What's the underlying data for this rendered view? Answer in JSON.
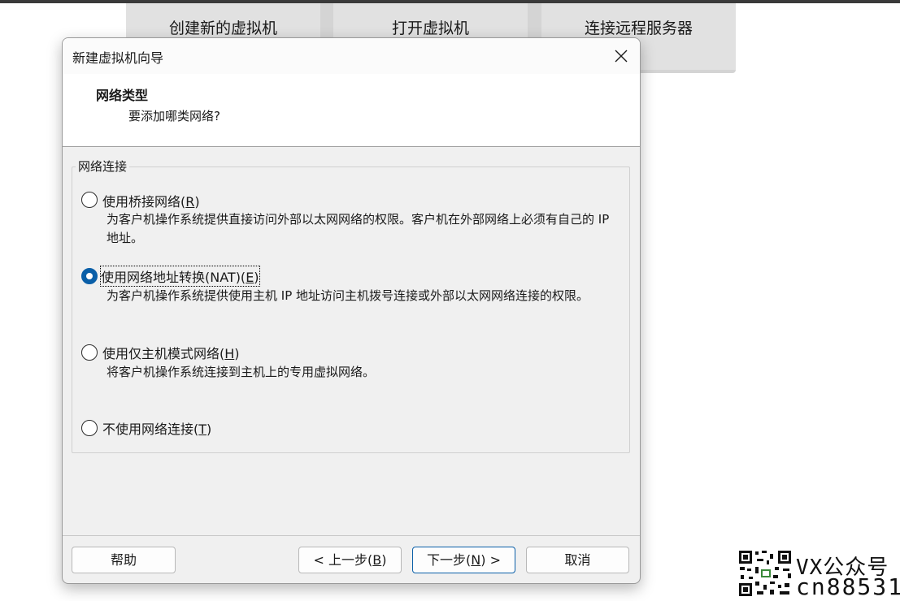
{
  "home": {
    "tiles": [
      "创建新的虚拟机",
      "打开虚拟机",
      "连接远程服务器"
    ]
  },
  "dialog": {
    "title": "新建虚拟机向导",
    "header": {
      "title": "网络类型",
      "subtitle": "要添加哪类网络?"
    },
    "group_label": "网络连接",
    "options": [
      {
        "label": "使用桥接网络(",
        "accel": "R",
        "label_end": ")",
        "description": "为客户机操作系统提供直接访问外部以太网网络的权限。客户机在外部网络上必须有自己的 IP 地址。",
        "selected": false
      },
      {
        "label": "使用网络地址转换(NAT)(",
        "accel": "E",
        "label_end": ")",
        "description": "为客户机操作系统提供使用主机 IP 地址访问主机拨号连接或外部以太网网络连接的权限。",
        "selected": true
      },
      {
        "label": "使用仅主机模式网络(",
        "accel": "H",
        "label_end": ")",
        "description": "将客户机操作系统连接到主机上的专用虚拟网络。",
        "selected": false
      },
      {
        "label": "不使用网络连接(",
        "accel": "T",
        "label_end": ")",
        "description": "",
        "selected": false
      }
    ],
    "buttons": {
      "help": "帮助",
      "back_prefix": "< 上一步(",
      "back_accel": "B",
      "back_suffix": ")",
      "next_prefix": "下一步(",
      "next_accel": "N",
      "next_suffix": ") >",
      "cancel": "取消"
    }
  },
  "watermark": {
    "line1": "VX公众号",
    "line2": "cn88531"
  },
  "colors": {
    "accent": "#0a5fa8",
    "dialog_bg": "#f0f0f0",
    "tile_bg": "#e1e1e1"
  }
}
